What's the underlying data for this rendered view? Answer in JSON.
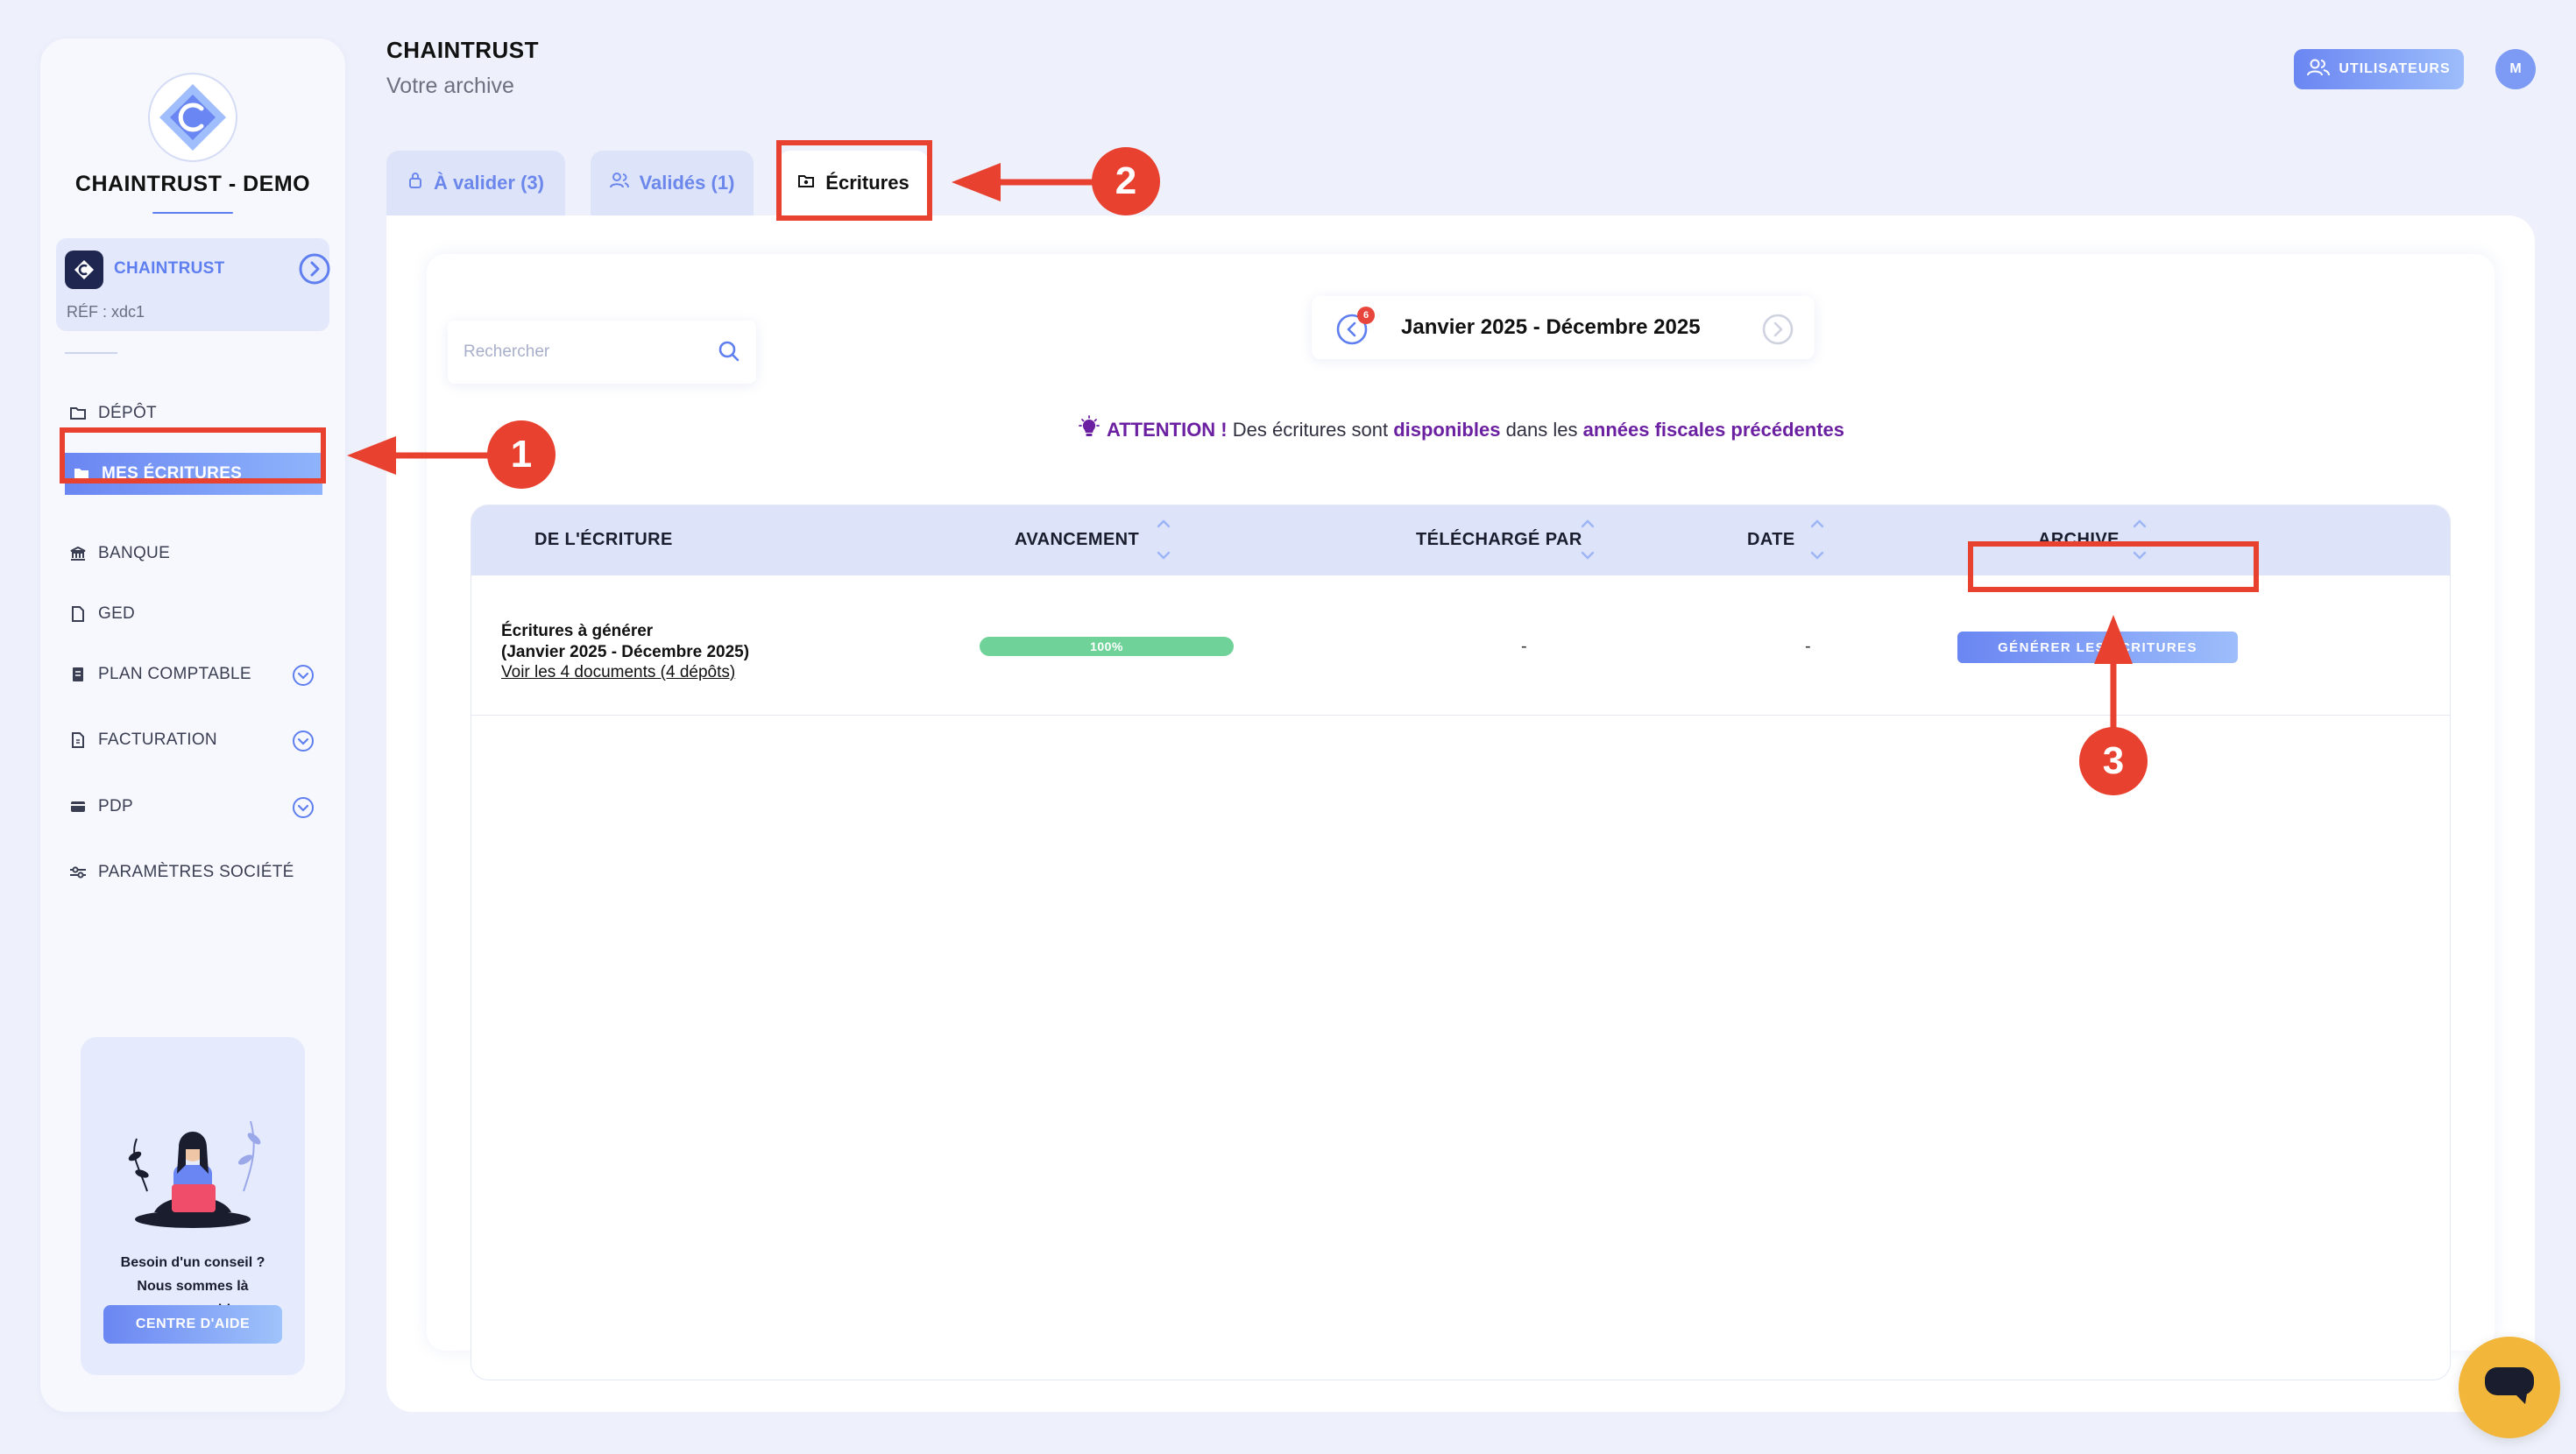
{
  "sidebar": {
    "company_title": "CHAINTRUST - DEMO",
    "org": {
      "name": "CHAINTRUST",
      "ref": "RÉF : xdc1"
    },
    "items": [
      {
        "label": "DÉPÔT",
        "icon": "folder-icon",
        "active": false
      },
      {
        "label": "MES ÉCRITURES",
        "icon": "folder-icon",
        "active": true
      },
      {
        "label": "BANQUE",
        "icon": "bank-icon",
        "active": false
      },
      {
        "label": "GED",
        "icon": "document-icon",
        "active": false
      },
      {
        "label": "PLAN COMPTABLE",
        "icon": "ledger-icon",
        "active": false,
        "expandable": true
      },
      {
        "label": "FACTURATION",
        "icon": "invoice-icon",
        "active": false,
        "expandable": true
      },
      {
        "label": "PDP",
        "icon": "card-icon",
        "active": false,
        "expandable": true
      },
      {
        "label": "PARAMÈTRES SOCIÉTÉ",
        "icon": "sliders-icon",
        "active": false
      }
    ],
    "help": {
      "line1": "Besoin d'un conseil ?",
      "line2": "Nous sommes là",
      "line3": "pour vous aider.",
      "button": "CENTRE D'AIDE"
    }
  },
  "header": {
    "title": "CHAINTRUST",
    "subtitle": "Votre archive",
    "users_button": "UTILISATEURS",
    "avatar_initial": "M"
  },
  "tabs": [
    {
      "label": "À valider (3)"
    },
    {
      "label": "Validés (1)"
    },
    {
      "label": "Écritures"
    }
  ],
  "search": {
    "placeholder": "Rechercher",
    "value": ""
  },
  "period": {
    "label": "Janvier 2025 - Décembre 2025",
    "badge": "6"
  },
  "attention": {
    "prefix": "ATTENTION !",
    "t1": "Des écritures sont",
    "b1": "disponibles",
    "t2": "dans les",
    "b2": "années fiscales précédentes"
  },
  "table": {
    "columns": [
      "DE L'ÉCRITURE",
      "AVANCEMENT",
      "TÉLÉCHARGÉ PAR",
      "DATE",
      "ARCHIVE"
    ],
    "rows": [
      {
        "name_line1": "Écritures à générer",
        "name_line2": "(Janvier 2025 - Décembre 2025)",
        "link": "Voir les 4 documents (4 dépôts)",
        "progress_label": "100%",
        "progress": 1.0,
        "uploaded_by": "-",
        "date": "-",
        "action": "GÉNÉRER LES ÉCRITURES"
      }
    ]
  },
  "annotations": {
    "one": "1",
    "two": "2",
    "three": "3"
  },
  "colors": {
    "accent": "#6a86f2",
    "annotation_red": "#e8412f",
    "progress_green": "#6fd399",
    "attention_purple": "#6b1fa1",
    "chat_yellow": "#f2b63a"
  }
}
